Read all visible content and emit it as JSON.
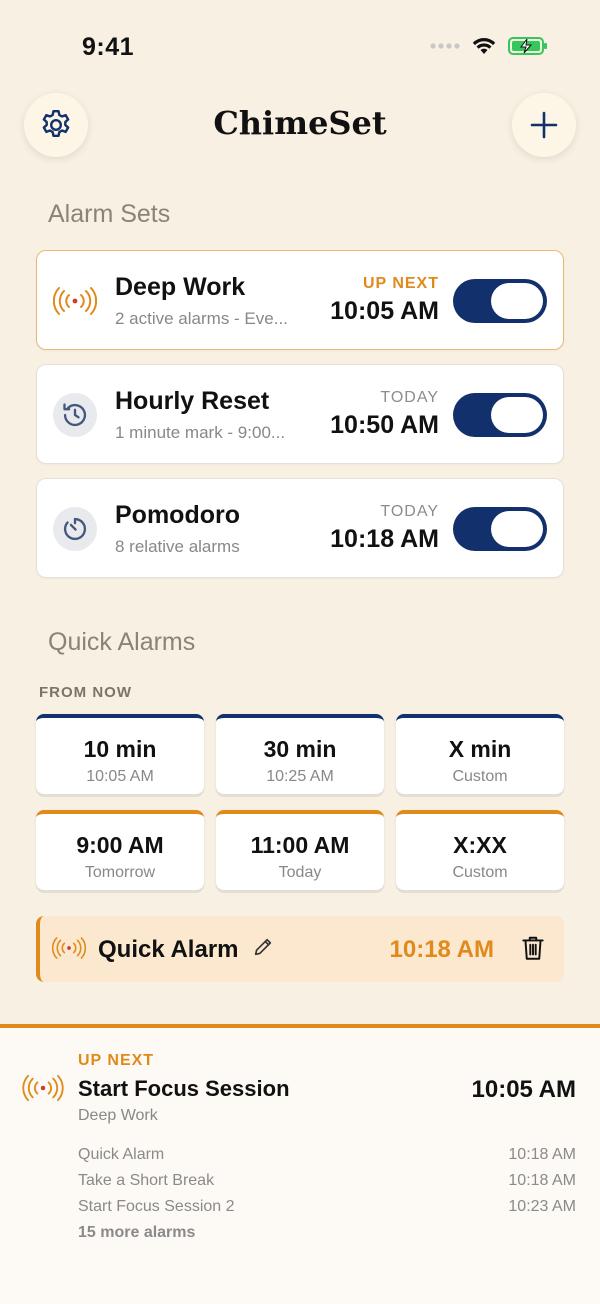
{
  "status_bar": {
    "time": "9:41"
  },
  "header": {
    "title": "ChimeSet"
  },
  "alarm_sets": {
    "section_title": "Alarm Sets",
    "items": [
      {
        "name": "Deep Work",
        "subtitle": "2 active alarms - Eve...",
        "label": "UP NEXT",
        "time": "10:05 AM",
        "enabled": true
      },
      {
        "name": "Hourly Reset",
        "subtitle": "1 minute mark - 9:00...",
        "label": "TODAY",
        "time": "10:50 AM",
        "enabled": true
      },
      {
        "name": "Pomodoro",
        "subtitle": "8 relative alarms",
        "label": "TODAY",
        "time": "10:18 AM",
        "enabled": true
      }
    ]
  },
  "quick_alarms": {
    "section_title": "Quick Alarms",
    "from_now_label": "FROM NOW",
    "tiles": [
      {
        "main": "10 min",
        "sub": "10:05 AM"
      },
      {
        "main": "30 min",
        "sub": "10:25 AM"
      },
      {
        "main": "X min",
        "sub": "Custom"
      },
      {
        "main": "9:00 AM",
        "sub": "Tomorrow"
      },
      {
        "main": "11:00 AM",
        "sub": "Today"
      },
      {
        "main": "X:XX",
        "sub": "Custom"
      }
    ],
    "active": {
      "label": "Quick Alarm",
      "time": "10:18 AM"
    }
  },
  "up_next": {
    "label": "UP NEXT",
    "title": "Start Focus Session",
    "set": "Deep Work",
    "time": "10:05 AM",
    "list": [
      {
        "name": "Quick Alarm",
        "time": "10:18 AM"
      },
      {
        "name": "Take a Short Break",
        "time": "10:18 AM"
      },
      {
        "name": "Start Focus Session 2",
        "time": "10:23 AM"
      }
    ],
    "more": "15 more alarms"
  },
  "colors": {
    "accent": "#e08a1c",
    "navy": "#12306b",
    "background": "#f8f0e3"
  }
}
